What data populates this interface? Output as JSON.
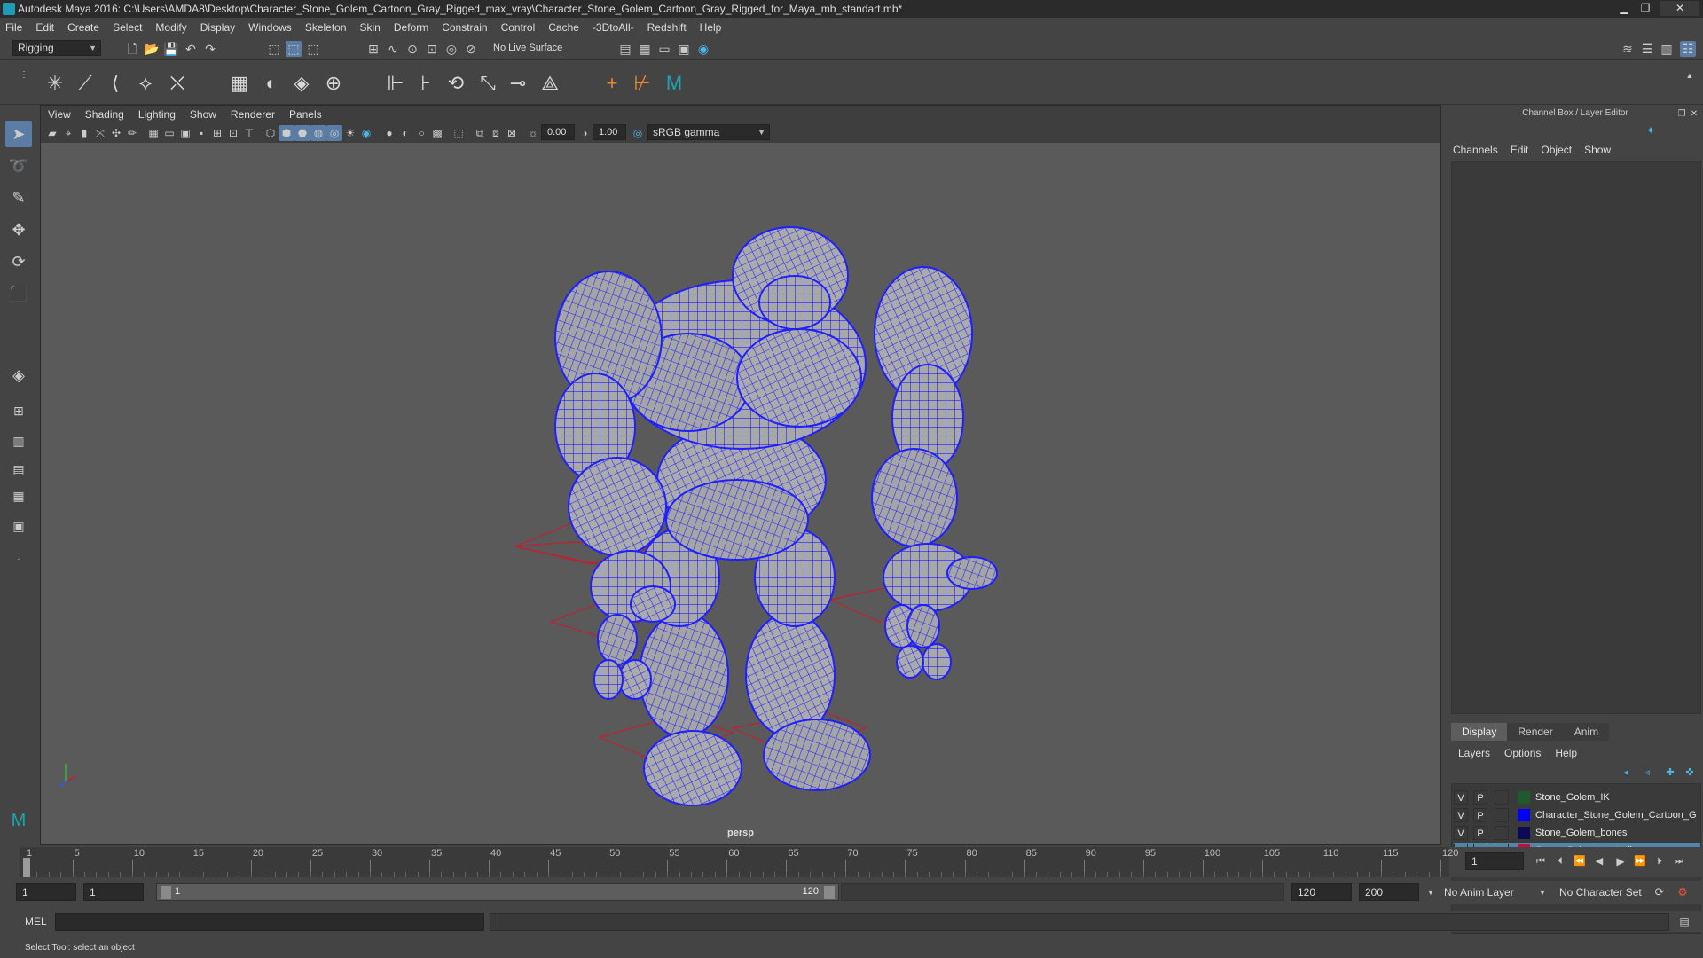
{
  "window": {
    "title": "Autodesk Maya 2016: C:\\Users\\AMDA8\\Desktop\\Character_Stone_Golem_Cartoon_Gray_Rigged_max_vray\\Character_Stone_Golem_Cartoon_Gray_Rigged_for_Maya_mb_standart.mb*",
    "minimize": "▁",
    "maximize": "❐",
    "close": "✕"
  },
  "menubar": [
    "File",
    "Edit",
    "Create",
    "Select",
    "Modify",
    "Display",
    "Windows",
    "Skeleton",
    "Skin",
    "Deform",
    "Constrain",
    "Control",
    "Cache",
    "-3DtoAll-",
    "Redshift",
    "Help"
  ],
  "statusline": {
    "mode": "Rigging",
    "live_surface": "No Live Surface"
  },
  "viewport": {
    "menu": [
      "View",
      "Shading",
      "Lighting",
      "Show",
      "Renderer",
      "Panels"
    ],
    "exposure": "0.00",
    "gamma": "1.00",
    "color_space": "sRGB gamma",
    "camera": "persp",
    "wire_color": "#1f1fff"
  },
  "channelbox": {
    "title": "Channel Box / Layer Editor",
    "menu": [
      "Channels",
      "Edit",
      "Object",
      "Show"
    ],
    "layer_tabs": [
      "Display",
      "Render",
      "Anim"
    ],
    "layer_menu": [
      "Layers",
      "Options",
      "Help"
    ],
    "layers": [
      {
        "v": "V",
        "p": "P",
        "name": "Stone_Golem_IK",
        "color": "#1e5a2c"
      },
      {
        "v": "V",
        "p": "P",
        "name": "Character_Stone_Golem_Cartoon_G",
        "color": "#0000ff"
      },
      {
        "v": "V",
        "p": "P",
        "name": "Stone_Golem_bones",
        "color": "#0a0a55"
      },
      {
        "v": "V",
        "p": "P",
        "name": "Stone_Golem_controllers",
        "color": "#c01040"
      }
    ]
  },
  "timeline": {
    "ticks": [
      "1",
      "5",
      "10",
      "15",
      "20",
      "25",
      "30",
      "35",
      "40",
      "45",
      "50",
      "55",
      "60",
      "65",
      "70",
      "75",
      "80",
      "85",
      "90",
      "95",
      "100",
      "105",
      "110",
      "115",
      "120"
    ],
    "current_frame": "1"
  },
  "range": {
    "start": "1",
    "playback_start": "1",
    "slider_start": "1",
    "slider_end": "120",
    "playback_end": "120",
    "end": "200",
    "anim_layer": "No Anim Layer",
    "character_set": "No Character Set"
  },
  "mel": {
    "label": "MEL"
  },
  "helpline": "Select Tool: select an object"
}
